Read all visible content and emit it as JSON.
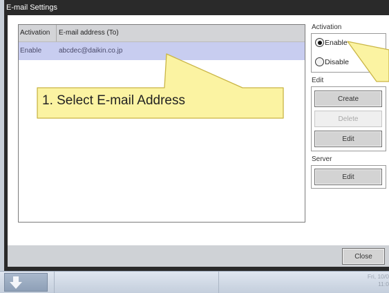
{
  "window": {
    "title": "E-mail Settings"
  },
  "table": {
    "columns": [
      "Activation",
      "E-mail address (To)"
    ],
    "rows": [
      {
        "activation": "Enable",
        "email": "abcdec@daikin.co.jp"
      }
    ]
  },
  "activation": {
    "label": "Activation",
    "options": [
      {
        "label": "Enable",
        "selected": true
      },
      {
        "label": "Disable",
        "selected": false
      }
    ]
  },
  "edit": {
    "label": "Edit",
    "create": "Create",
    "delete": "Delete",
    "edit": "Edit"
  },
  "server": {
    "label": "Server",
    "edit": "Edit"
  },
  "footer": {
    "close": "Close"
  },
  "taskbar": {
    "date": "Fri, 10/0",
    "time": "11:0"
  },
  "annotation": {
    "text": "1. Select  E-mail Address"
  },
  "colors": {
    "callout_fill": "#fbf3a2",
    "callout_stroke": "#c9b545",
    "selected_row": "#c8cdf0"
  }
}
